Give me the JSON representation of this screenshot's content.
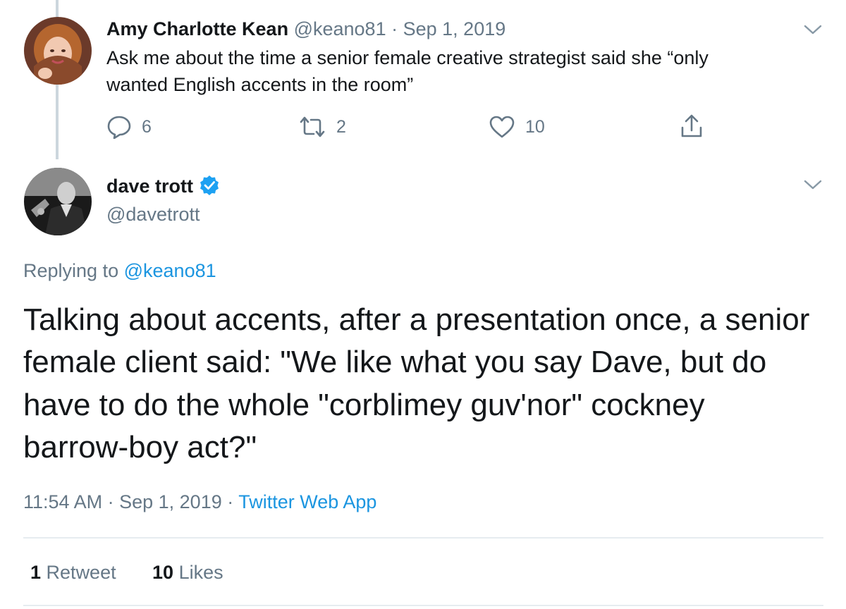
{
  "parent_tweet": {
    "author_name": "Amy Charlotte Kean",
    "author_handle": "@keano81",
    "separator": "·",
    "date": "Sep 1, 2019",
    "text_line1": "Ask me about the time a senior female creative strategist said she “only",
    "text_line2": "wanted English accents in the room”",
    "reply_count": "6",
    "retweet_count": "2",
    "like_count": "10"
  },
  "main_tweet": {
    "author_name": "dave trott",
    "author_handle": "@davetrott",
    "replying_prefix": "Replying to",
    "replying_handle": "@keano81",
    "text_line1": "Talking about accents, after a presentation once, a senior",
    "text_line2": "female client said: \"We like what you say Dave, but do",
    "text_line3": "have to do the whole \"corblimey guv'nor\" cockney",
    "text_line4": "barrow-boy act?\"",
    "time": "11:54 AM",
    "sep": "·",
    "date": "Sep 1, 2019",
    "source": "Twitter Web App",
    "stats": {
      "retweets_count": "1",
      "retweets_label": "Retweet",
      "likes_count": "10",
      "likes_label": "Likes"
    }
  },
  "colors": {
    "link": "#1b95e0",
    "muted": "#657786",
    "text": "#14171a",
    "verified": "#1da1f2",
    "divider": "#e6ecf0"
  },
  "icons": [
    "reply-icon",
    "retweet-icon",
    "like-icon",
    "share-icon",
    "chevron-down-icon",
    "verified-badge-icon"
  ]
}
